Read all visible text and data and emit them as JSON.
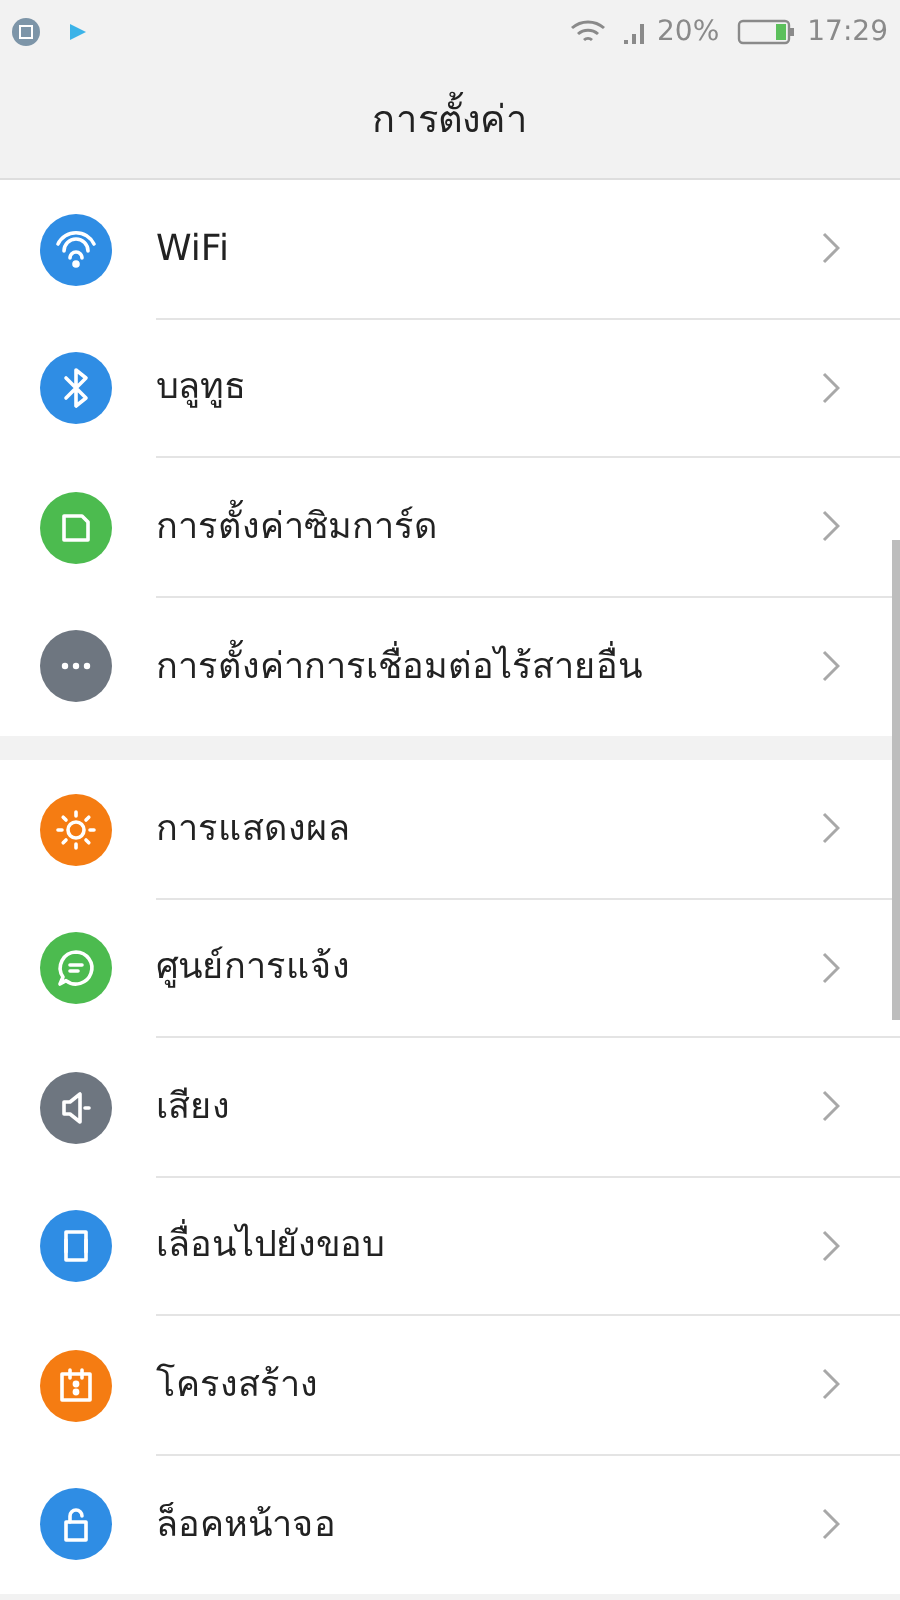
{
  "status_bar": {
    "battery": "20%",
    "time": "17:29"
  },
  "header": {
    "title": "การตั้งค่า"
  },
  "groups": [
    {
      "items": [
        {
          "label": "WiFi",
          "kind": "wifi",
          "color": "#2f8de4"
        },
        {
          "label": "บลูทูธ",
          "kind": "bluetooth",
          "color": "#2f8de4"
        },
        {
          "label": "การตั้งค่าซิมการ์ด",
          "kind": "sim",
          "color": "#4cbb4f"
        },
        {
          "label": "การตั้งค่าการเชื่อมต่อไร้สายอื่น",
          "kind": "more",
          "color": "#6e7680"
        }
      ]
    },
    {
      "items": [
        {
          "label": "การแสดงผล",
          "kind": "display",
          "color": "#f57c12"
        },
        {
          "label": "ศูนย์การแจ้ง",
          "kind": "message",
          "color": "#4cbb4f"
        },
        {
          "label": "เสียง",
          "kind": "sound",
          "color": "#6e7680"
        },
        {
          "label": "เลื่อนไปยังขอบ",
          "kind": "edge",
          "color": "#2f8de4"
        },
        {
          "label": "โครงสร้าง",
          "kind": "calendar",
          "color": "#f57c12"
        },
        {
          "label": "ล็อคหน้าจอ",
          "kind": "lock",
          "color": "#2f8de4"
        }
      ]
    }
  ]
}
